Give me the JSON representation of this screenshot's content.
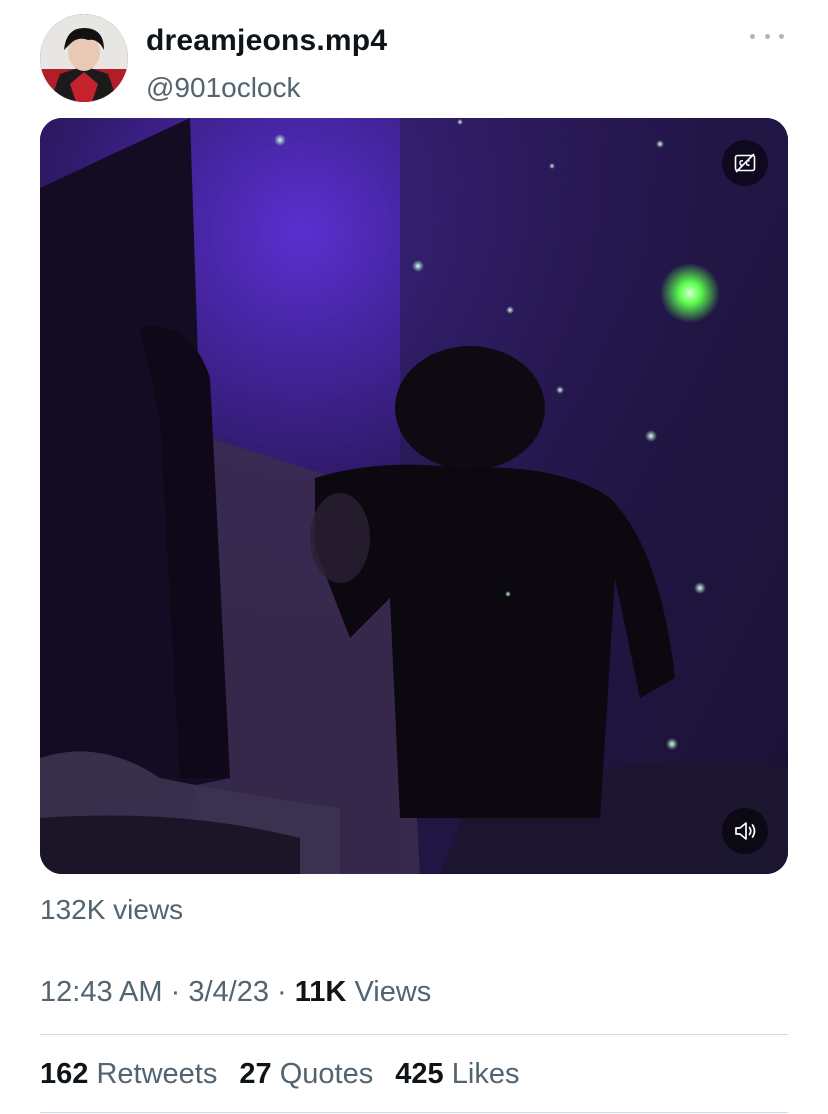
{
  "user": {
    "display_name": "dreamjeons.mp4",
    "handle": "@901oclock",
    "avatar": "profile-photo"
  },
  "media": {
    "type": "video",
    "captions_icon": "closed-captions-off-icon",
    "volume_icon": "speaker-muted-icon"
  },
  "views_label": "132K views",
  "meta": {
    "time": "12:43 AM",
    "sep1": "·",
    "date": "3/4/23",
    "sep2": "·",
    "views_count": "11K",
    "views_word": "Views"
  },
  "stats": [
    {
      "count": "162",
      "label": "Retweets"
    },
    {
      "count": "27",
      "label": "Quotes"
    },
    {
      "count": "425",
      "label": "Likes"
    }
  ],
  "colors": {
    "text_primary": "#0f1419",
    "text_secondary": "#536471",
    "divider": "#cfd9de",
    "scene_purple": "#3b1f78",
    "laser_green": "#7dff6a"
  }
}
